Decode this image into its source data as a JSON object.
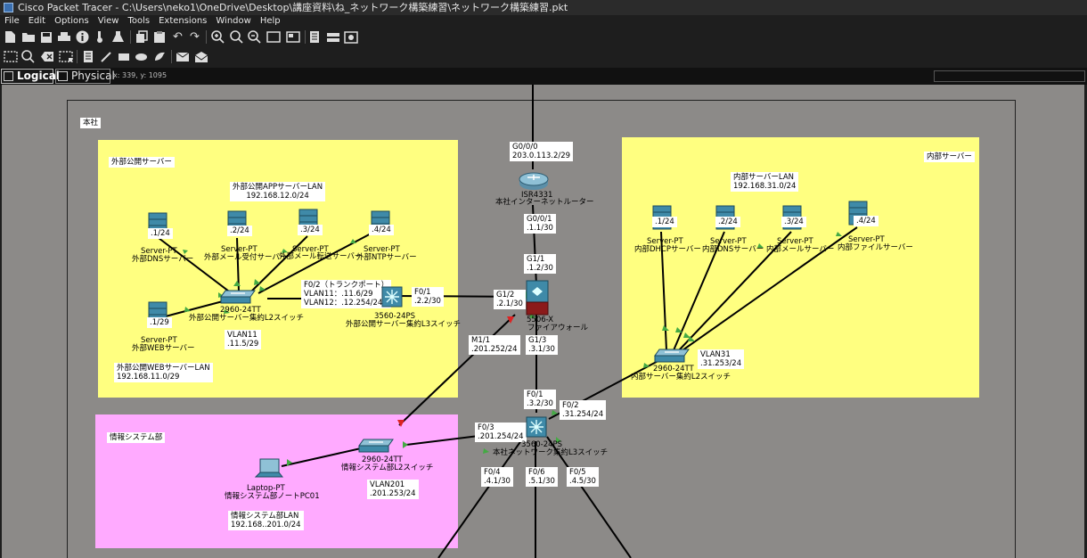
{
  "window": {
    "title": "Cisco Packet Tracer - C:\\Users\\neko1\\OneDrive\\Desktop\\講座資料\\ね_ネットワーク構築練習\\ネットワーク構築練習.pkt"
  },
  "menu": [
    "File",
    "Edit",
    "Options",
    "View",
    "Tools",
    "Extensions",
    "Window",
    "Help"
  ],
  "mode_tabs": {
    "logical": "Logical",
    "physical": "Physical"
  },
  "cursor_coords": "x: 339, y: 1095",
  "clusters": {
    "hq": "本社",
    "ext_servers": "外部公開サーバー",
    "int_servers": "内部サーバー",
    "info_dept": "情報システム部"
  },
  "ext": {
    "app_lan": [
      "外部公開APPサーバーLAN",
      "192.168.12.0/24"
    ],
    "web_lan": [
      "外部公開WEBサーバーLAN",
      "192.168.11.0/29"
    ],
    "servers": [
      {
        "ip": ".1/24",
        "type": "Server-PT",
        "name": "外部DNSサーバー"
      },
      {
        "ip": ".2/24",
        "type": "Server-PT",
        "name": "外部メール受付サーバー"
      },
      {
        "ip": ".3/24",
        "type": "Server-PT",
        "name": "外部メール転送サーバー"
      },
      {
        "ip": ".4/24",
        "type": "Server-PT",
        "name": "外部NTPサーバー"
      }
    ],
    "web_server": {
      "ip": ".1/29",
      "type": "Server-PT",
      "name": "外部WEBサーバー"
    },
    "l2switch": {
      "type": "2960-24TT",
      "name": "外部公開サーバー集約L2スイッチ",
      "vlan": [
        "VLAN11",
        ".11.5/29"
      ]
    },
    "trunk": [
      "F0/2（トランクポート）",
      "VLAN11：.11.6/29",
      "VLAN12：.12.254/24"
    ],
    "l3switch": {
      "type": "3560-24PS",
      "name": "外部公開サーバー集約L3スイッチ",
      "port": [
        "F0/1",
        ".2.2/30"
      ]
    }
  },
  "router": {
    "port_top": [
      "G0/0/0",
      "203.0.113.2/29"
    ],
    "type": "ISR4331",
    "name": "本社インターネットルーター",
    "port_bottom": [
      "G0/0/1",
      ".1.1/30"
    ]
  },
  "firewall": {
    "type": "5506-X",
    "name": "ファイアウォール",
    "g11": [
      "G1/1",
      ".1.2/30"
    ],
    "g12": [
      "G1/2",
      ".2.1/30"
    ],
    "m11": [
      "M1/1",
      ".201.252/24"
    ],
    "g13": [
      "G1/3",
      ".3.1/30"
    ]
  },
  "core": {
    "type": "3560-24PS",
    "name": "本社ネットワーク集約L3スイッチ",
    "f01": [
      "F0/1",
      ".3.2/30"
    ],
    "f02": [
      "F0/2",
      ".31.254/24"
    ],
    "f03": [
      "F0/3",
      ".201.254/24"
    ],
    "f04": [
      "F0/4",
      ".4.1/30"
    ],
    "f06": [
      "F0/6",
      ".5.1/30"
    ],
    "f05": [
      "F0/5",
      ".4.5/30"
    ]
  },
  "int": {
    "lan": [
      "内部サーバーLAN",
      "192.168.31.0/24"
    ],
    "servers": [
      {
        "ip": ".1/24",
        "type": "Server-PT",
        "name": "内部DHCPサーバー"
      },
      {
        "ip": ".2/24",
        "type": "Server-PT",
        "name": "内部DNSサーバー"
      },
      {
        "ip": ".3/24",
        "type": "Server-PT",
        "name": "内部メールサーバー"
      },
      {
        "ip": ".4/24",
        "type": "Server-PT",
        "name": "内部ファイルサーバー"
      }
    ],
    "l2switch": {
      "type": "2960-24TT",
      "name": "内部サーバー集約L2スイッチ",
      "vlan": [
        "VLAN31",
        ".31.253/24"
      ]
    }
  },
  "info": {
    "lan": [
      "情報システム部LAN",
      "192.168..201.0/24"
    ],
    "laptop": {
      "type": "Laptop-PT",
      "name": "情報システム部ノートPC01"
    },
    "l2switch": {
      "type": "2960-24TT",
      "name": "情報システム部L2スイッチ",
      "vlan": [
        "VLAN201",
        ".201.253/24"
      ]
    }
  },
  "colors": {
    "workspace": "#8c8a88",
    "yellow_cluster": "#ffff80",
    "pink_cluster": "#ffaaff",
    "link_up": "#44aa44",
    "link_down": "#dd2222"
  },
  "icons": [
    "new-file-icon",
    "open-folder-icon",
    "save-icon",
    "print-icon",
    "info-icon",
    "wizard-icon",
    "copy-icon",
    "paste-icon",
    "undo-icon",
    "redo-icon",
    "zoom-in-icon",
    "zoom-reset-icon",
    "zoom-out-icon",
    "drawing-palette-icon",
    "custom-device-icon",
    "notes-icon",
    "cluster-icon",
    "screenshot-icon",
    "select-icon",
    "inspect-icon",
    "delete-icon",
    "resize-icon",
    "note-icon",
    "line-icon",
    "rectangle-icon",
    "ellipse-icon",
    "freeform-icon",
    "simple-pdu-icon",
    "complex-pdu-icon"
  ]
}
